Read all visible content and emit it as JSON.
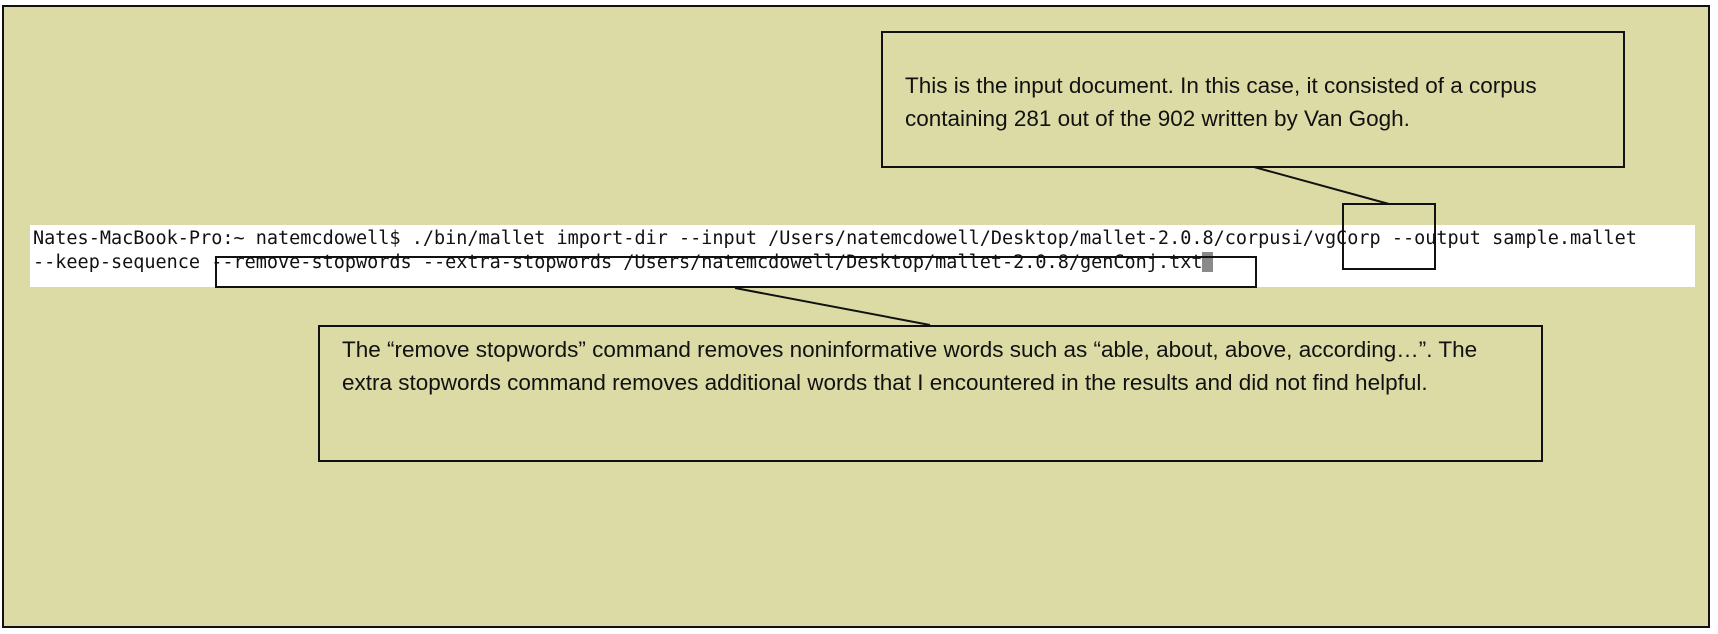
{
  "terminal": {
    "line1": "Nates-MacBook-Pro:~ natemcdowell$ ./bin/mallet import-dir --input /Users/natemcdowell/Desktop/mallet-2.0.8/corpusi/vgCorp --output sample.mallet",
    "line2": "--keep-sequence --remove-stopwords --extra-stopwords /Users/natemcdowell/Desktop/mallet-2.0.8/genConj.txt"
  },
  "callouts": {
    "input": {
      "text": "This is the input document. In this case, it consisted of a corpus containing 281 out of the 902 written by Van Gogh."
    },
    "stopwords": {
      "text": "The “remove stopwords” command removes noninformative words such as “able, about, above, according…”. The extra stopwords command removes additional words that I encountered in the results and did not find helpful."
    }
  },
  "colors": {
    "panel_background": "#dcdba6",
    "border": "#111111",
    "terminal_background": "#ffffff",
    "cursor": "#8a8a8a"
  }
}
